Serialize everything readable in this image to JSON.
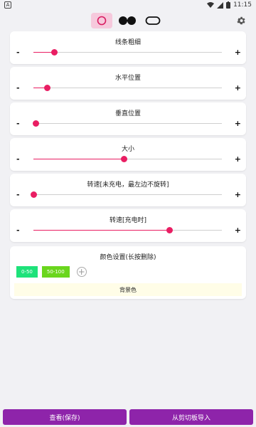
{
  "status": {
    "app_letter": "A",
    "time": "11:15"
  },
  "shape_tabs": [
    "circle",
    "dual-circles",
    "rounded-rect"
  ],
  "sliders": [
    {
      "label": "线条粗细",
      "value": 0.11
    },
    {
      "label": "水平位置",
      "value": 0.07
    },
    {
      "label": "垂直位置",
      "value": 0.01
    },
    {
      "label": "大小",
      "value": 0.48
    },
    {
      "label": "转速[未充电，最左边不旋转]",
      "value": 0.0
    },
    {
      "label": "转速[充电时]",
      "value": 0.72
    }
  ],
  "slider_controls": {
    "minus": "-",
    "plus": "+"
  },
  "color_settings": {
    "title": "颜色设置(长按删除)",
    "chips": [
      {
        "label": "0-50",
        "color": "#1ee27a"
      },
      {
        "label": "50-100",
        "color": "#6ad61d"
      }
    ],
    "add_symbol": "+",
    "background_label": "背景色"
  },
  "buttons": {
    "view_save": "查看(保存)",
    "import_clipboard": "从剪切板导入"
  },
  "colors": {
    "accent": "#e91e63",
    "button": "#8e24aa",
    "active_tab": "#f6c9dc"
  }
}
